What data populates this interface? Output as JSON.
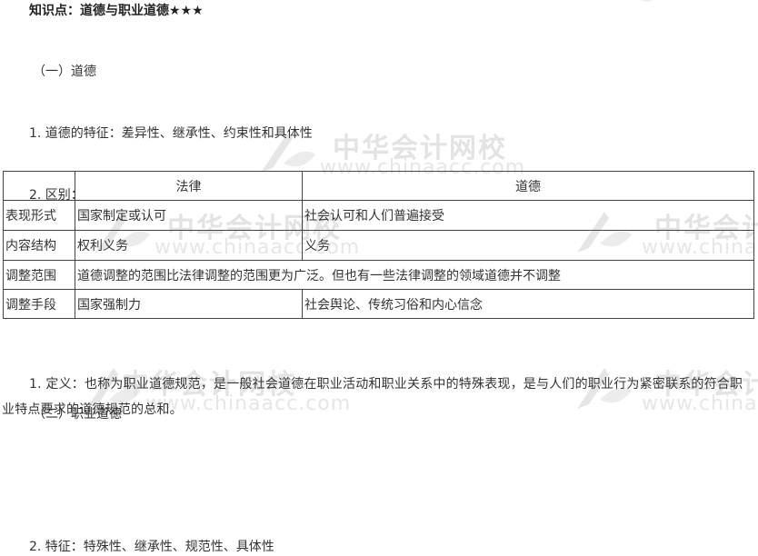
{
  "title": "知识点：道德与职业道德★★★",
  "section1": {
    "heading": "（一）道德",
    "point1": "1. 道德的特征：差异性、继承性、约束性和具体性",
    "point2": "2. 区别："
  },
  "table": {
    "header": [
      "",
      "法律",
      "道德"
    ],
    "rows": [
      {
        "label": "表现形式",
        "law": "国家制定或认可",
        "morality": "社会认可和人们普遍接受"
      },
      {
        "label": "内容结构",
        "law": "权利义务",
        "morality": "义务"
      },
      {
        "label": "调整范围",
        "merged": "道德调整的范围比法律调整的范围更为广泛。但也有一些法律调整的领域道德并不调整"
      },
      {
        "label": "调整手段",
        "law": "国家强制力",
        "morality": "社会舆论、传统习俗和内心信念"
      }
    ]
  },
  "section2": {
    "heading": "（二）职业道德",
    "point1": "1. 定义：也称为职业道德规范，是一般社会道德在职业活动和职业关系中的特殊表现，是与人们的职业行为紧密联系的符合职业特点要求的道德规范的总和。",
    "point2": "2. 特征：特殊性、继承性、规范性、具体性"
  },
  "watermark": {
    "cn": "中华会计网校",
    "en": "www.chinaacc.com",
    "colors": {
      "logo_a": "#dcdcdc",
      "logo_b": "#e8e8e8"
    }
  }
}
